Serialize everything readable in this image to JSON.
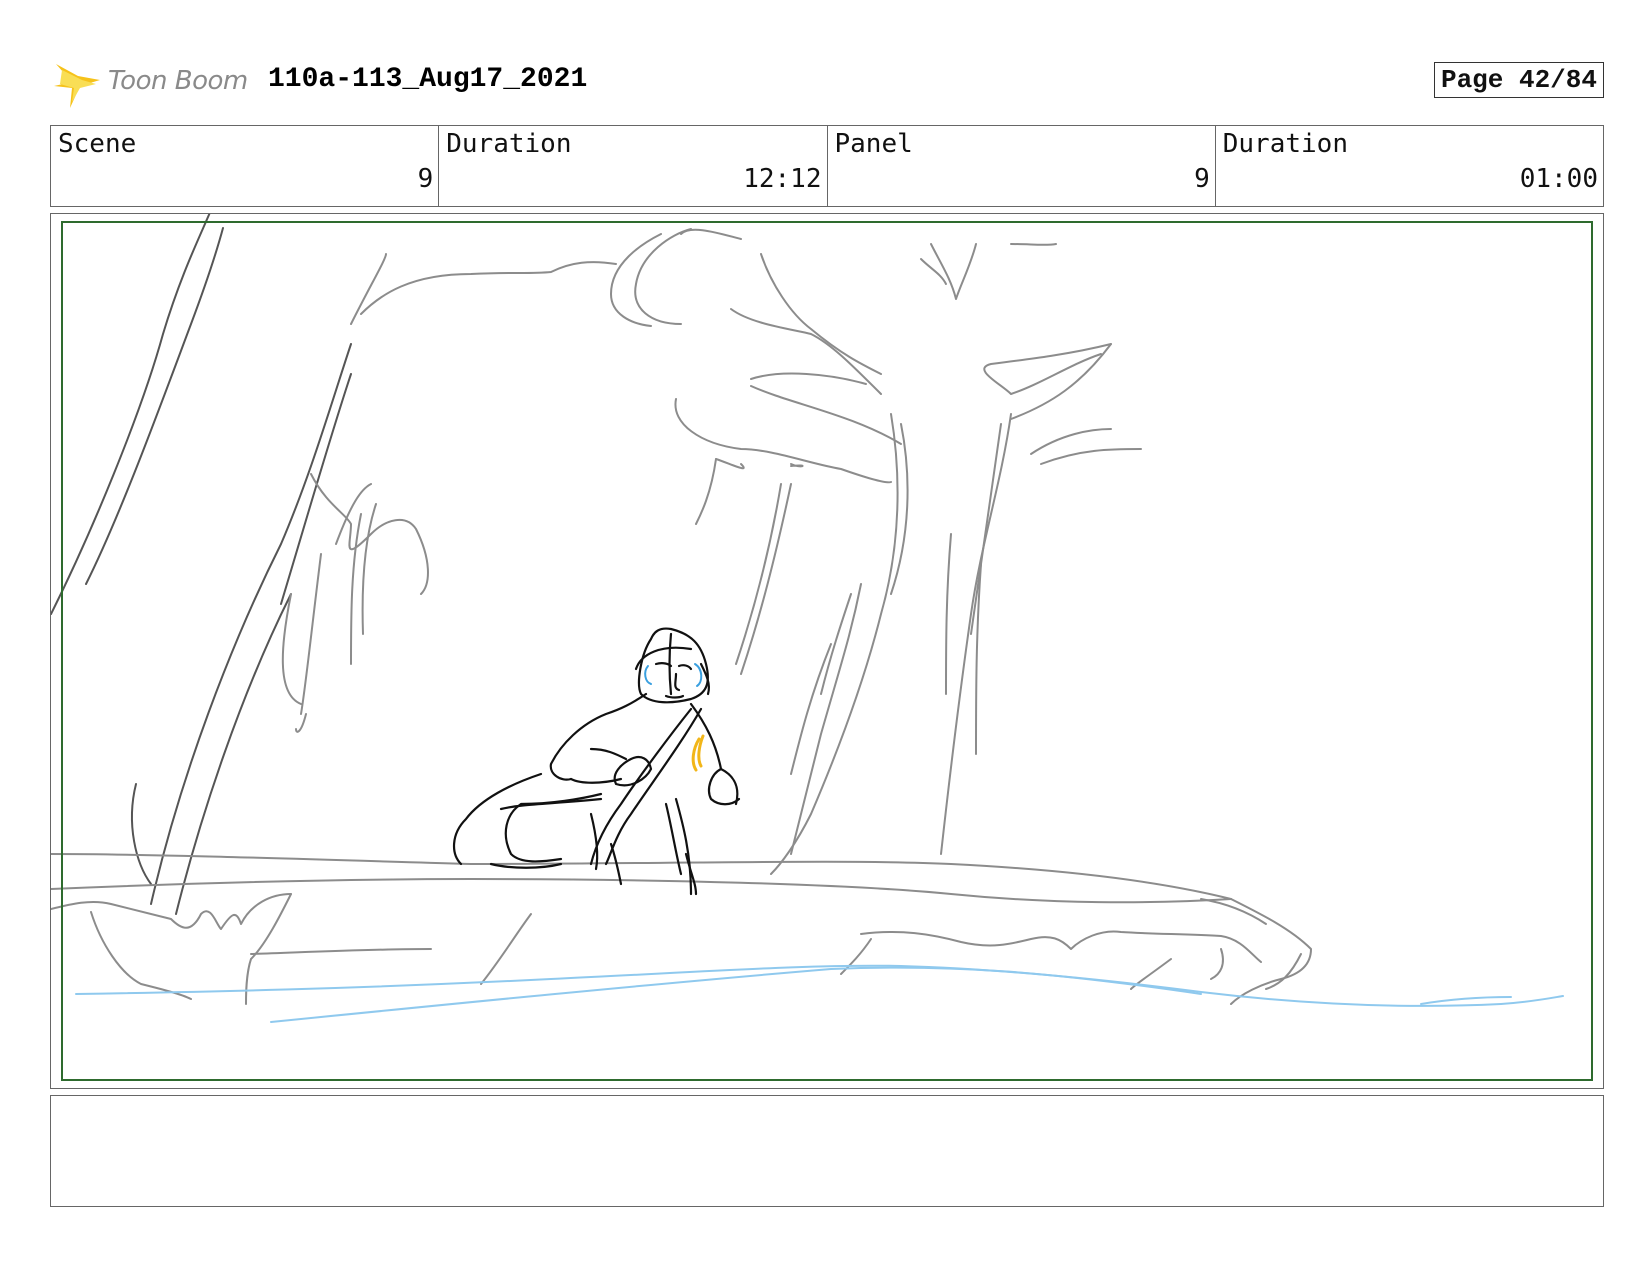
{
  "header": {
    "logo_text": "Toon Boom",
    "project_title": "110a-113_Aug17_2021",
    "page_label": "Page 42/84"
  },
  "info": [
    {
      "label": "Scene",
      "value": "9"
    },
    {
      "label": "Duration",
      "value": "12:12"
    },
    {
      "label": "Panel",
      "value": "9"
    },
    {
      "label": "Duration",
      "value": "01:00"
    }
  ],
  "panel": {
    "image_description_icon": "sketch-forest-character-crouching",
    "colors": {
      "safe_area": "#2e6b2e",
      "sketch_gray": "#8c8c8c",
      "sketch_dark": "#555555",
      "character": "#111111",
      "water": "#8fc9ee",
      "accent_blue": "#3aa0e0",
      "accent_yellow": "#f2b619"
    }
  },
  "caption": {
    "text": ""
  }
}
